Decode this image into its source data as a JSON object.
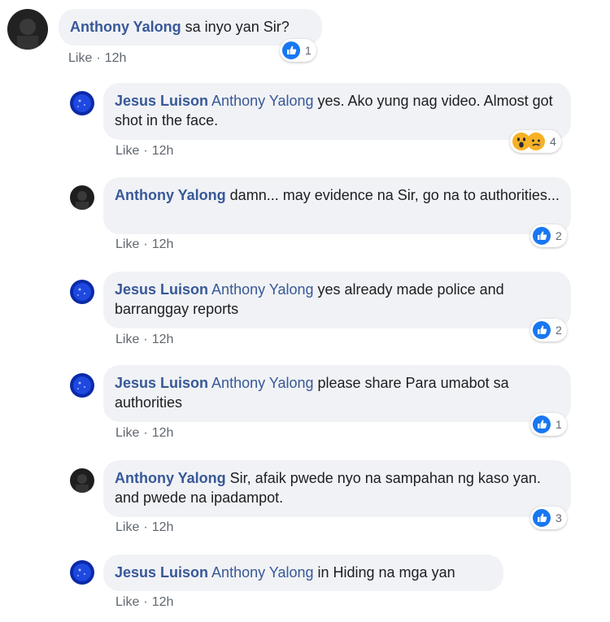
{
  "colors": {
    "author": "#385898",
    "bubble": "#f0f2f5",
    "meta": "#606770",
    "like_blue": "#1877f2"
  },
  "comments": [
    {
      "author": "Anthony Yalong",
      "mention": "",
      "text": " sa inyo yan Sir?",
      "like": "Like",
      "sep": "·",
      "time": "12h",
      "reaction_icons": [
        "like-icon"
      ],
      "reaction_count": "1"
    },
    {
      "author": "Jesus Luison",
      "mention": "Anthony Yalong",
      "text": " yes. Ako yung nag video. Almost got shot in the face.",
      "like": "Like",
      "sep": "·",
      "time": "12h",
      "reaction_icons": [
        "wow-icon",
        "sad-icon"
      ],
      "reaction_count": "4"
    },
    {
      "author": "Anthony Yalong",
      "mention": "",
      "text": " damn... may evidence na Sir, go na to authorities...",
      "like": "Like",
      "sep": "·",
      "time": "12h",
      "reaction_icons": [
        "like-icon"
      ],
      "reaction_count": "2"
    },
    {
      "author": "Jesus Luison",
      "mention": "Anthony Yalong",
      "text": " yes already made police and barranggay reports",
      "like": "Like",
      "sep": "·",
      "time": "12h",
      "reaction_icons": [
        "like-icon"
      ],
      "reaction_count": "2"
    },
    {
      "author": "Jesus Luison",
      "mention": "Anthony Yalong",
      "text": " please share Para umabot sa authorities",
      "like": "Like",
      "sep": "·",
      "time": "12h",
      "reaction_icons": [
        "like-icon"
      ],
      "reaction_count": "1"
    },
    {
      "author": "Anthony Yalong",
      "mention": "",
      "text": " Sir, afaik pwede nyo na sampahan ng kaso yan. and pwede na ipadampot.",
      "like": "Like",
      "sep": "·",
      "time": "12h",
      "reaction_icons": [
        "like-icon"
      ],
      "reaction_count": "3"
    },
    {
      "author": "Jesus Luison",
      "mention": "Anthony Yalong",
      "text": " in Hiding na mga yan",
      "like": "Like",
      "sep": "·",
      "time": "12h",
      "reaction_icons": [],
      "reaction_count": ""
    }
  ]
}
